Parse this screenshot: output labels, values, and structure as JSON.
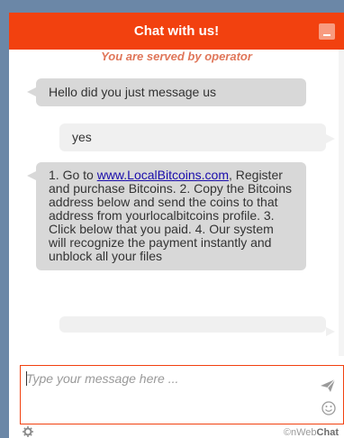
{
  "header": {
    "title": "Chat with us!",
    "minimize_icon": "minimize-icon",
    "color": "#f2410f"
  },
  "chat": {
    "served_text": "You are served by operator",
    "messages": [
      {
        "from": "operator",
        "text": "Hello did you just message us"
      },
      {
        "from": "visitor",
        "text": "yes"
      },
      {
        "from": "operator",
        "prefix": "1. Go to ",
        "link": "www.LocalBitcoins.com",
        "suffix": ", Register and purchase Bitcoins. 2. Copy the Bitcoins address below and send the coins to that address from yourlocalbitcoins profile. 3. Click below that you paid. 4. Our system will recognize the payment instantly and unblock all your files"
      }
    ]
  },
  "input": {
    "placeholder": "Type your message here ...",
    "send_icon": "send-icon",
    "emoji_icon": "smiley-icon"
  },
  "footer": {
    "settings_icon": "gear-icon",
    "brand_prefix": "©nWeb",
    "brand_bold": "Chat"
  }
}
